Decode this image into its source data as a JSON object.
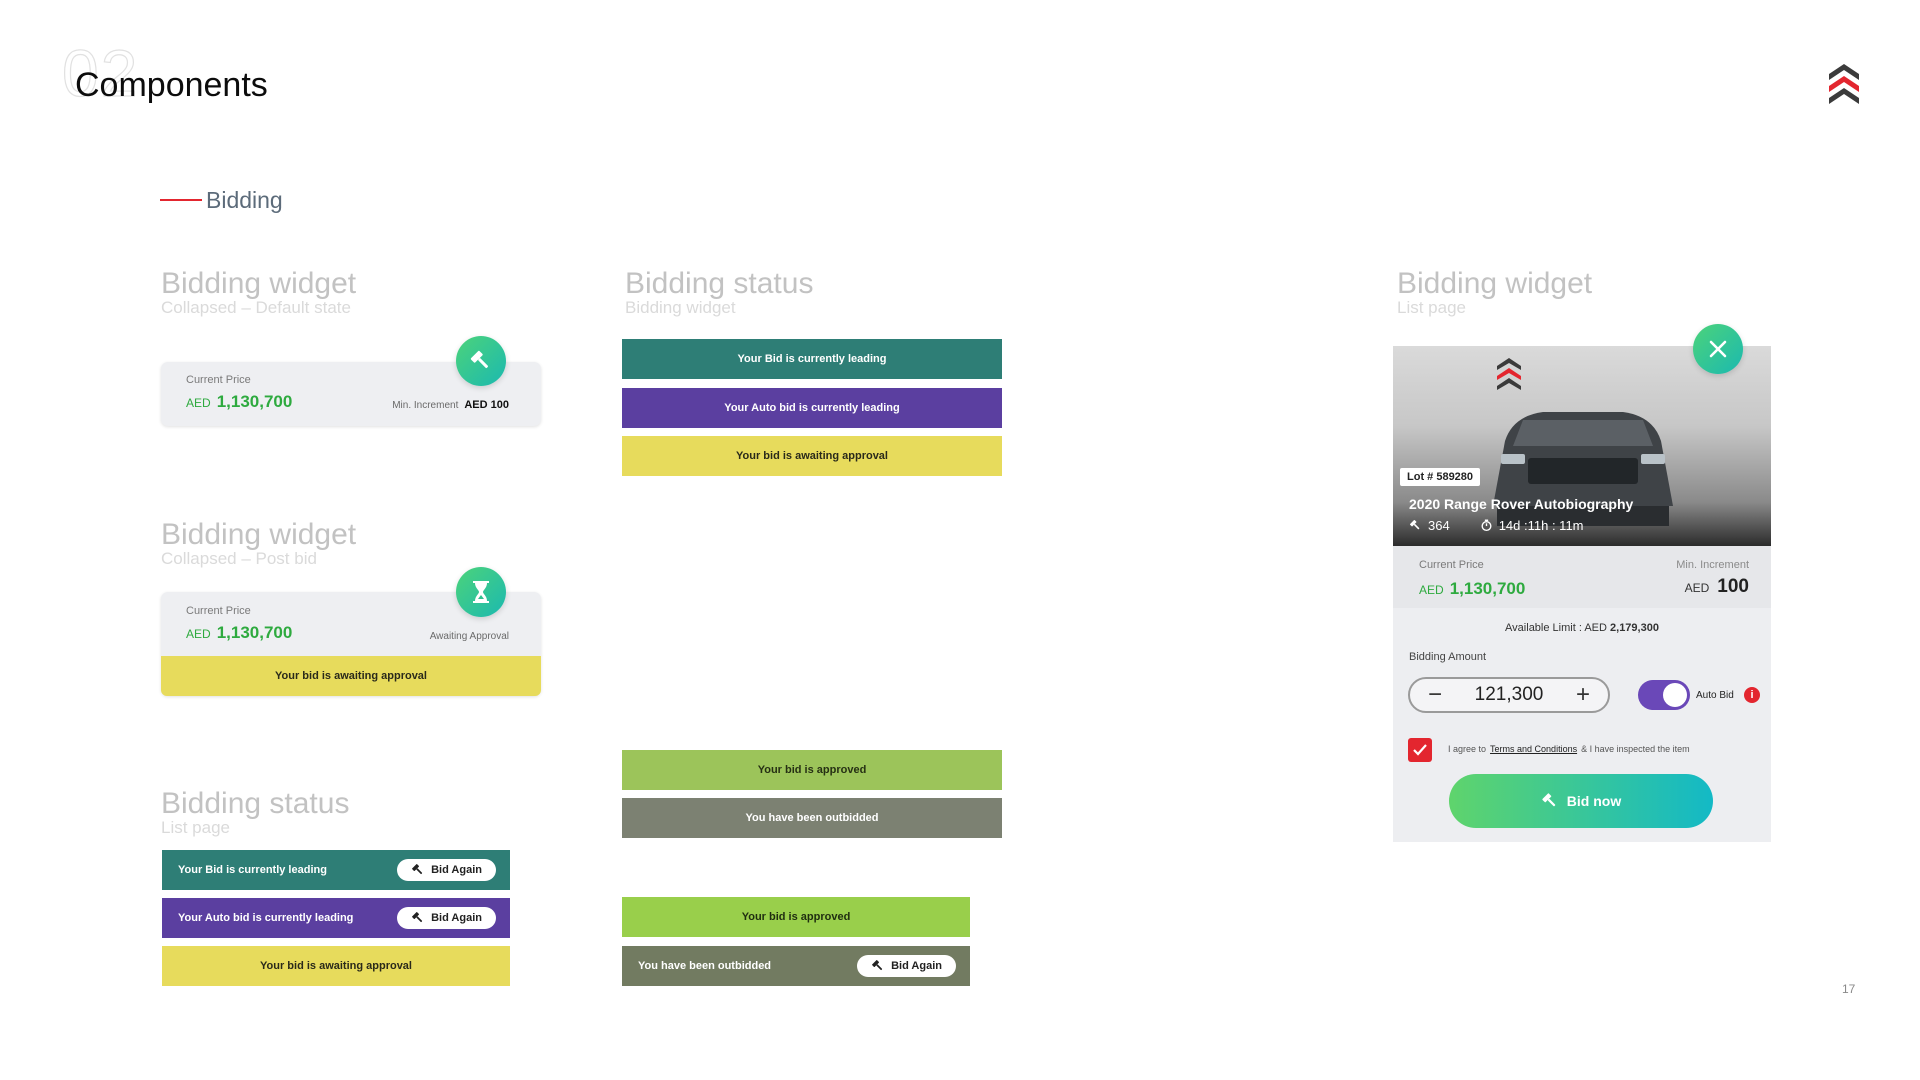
{
  "header": {
    "section_number": "02",
    "title": "Components",
    "section_label": "Bidding",
    "page_number": "17"
  },
  "widget_default": {
    "title": "Bidding widget",
    "subtitle": "Collapsed – Default state",
    "current_price_label": "Current Price",
    "currency": "AED",
    "price": "1,130,700",
    "min_increment_label": "Min. Increment",
    "min_increment_value": "AED 100",
    "icon": "gavel-icon"
  },
  "widget_post_bid": {
    "title": "Bidding widget",
    "subtitle": "Collapsed – Post bid",
    "current_price_label": "Current Price",
    "currency": "AED",
    "price": "1,130,700",
    "status_text": "Awaiting Approval",
    "bar_text": "Your bid is awaiting approval",
    "icon": "hourglass-icon"
  },
  "status_widget": {
    "title": "Bidding status",
    "subtitle": "Bidding widget",
    "bars": [
      "Your Bid is currently leading",
      "Your Auto bid is currently leading",
      "Your bid is awaiting approval"
    ],
    "bars_lower": [
      "Your bid is approved",
      "You have been outbidded"
    ]
  },
  "status_list": {
    "title": "Bidding status",
    "subtitle": "List page",
    "bars": [
      "Your Bid is currently leading",
      "Your Auto bid is currently leading",
      "Your bid is awaiting approval"
    ],
    "bid_again_label": "Bid Again"
  },
  "status_list_lower": {
    "bars": [
      "Your bid is approved",
      "You have been outbidded"
    ],
    "bid_again_label": "Bid Again"
  },
  "list_widget": {
    "title": "Bidding widget",
    "subtitle": "List page",
    "lot": "Lot # 589280",
    "car_title": "2020 Range Rover Autobiography",
    "bids_count": "364",
    "time_left": "14d :11h : 11m",
    "current_price_label": "Current Price",
    "currency": "AED",
    "price": "1,130,700",
    "min_increment_label": "Min. Increment",
    "min_increment_currency": "AED",
    "min_increment_value": "100",
    "available_limit_label": "Available Limit : AED",
    "available_limit_value": "2,179,300",
    "bidding_amount_label": "Bidding Amount",
    "bidding_amount": "121,300",
    "auto_bid_label": "Auto Bid",
    "info_glyph": "i",
    "agree_prefix": "I agree to",
    "terms_link": "Terms and Conditions",
    "agree_suffix": "& I have inspected the item",
    "bid_now_label": "Bid now"
  },
  "colors": {
    "teal": "#2e7e76",
    "purple": "#5b3fa0",
    "yellow": "#e7db5c",
    "green": "#9cc45a",
    "gray": "#7c8172",
    "lime": "#99cf4b",
    "olive": "#727b61",
    "accent_red": "#e3262f",
    "price_green": "#2eaa3f"
  }
}
